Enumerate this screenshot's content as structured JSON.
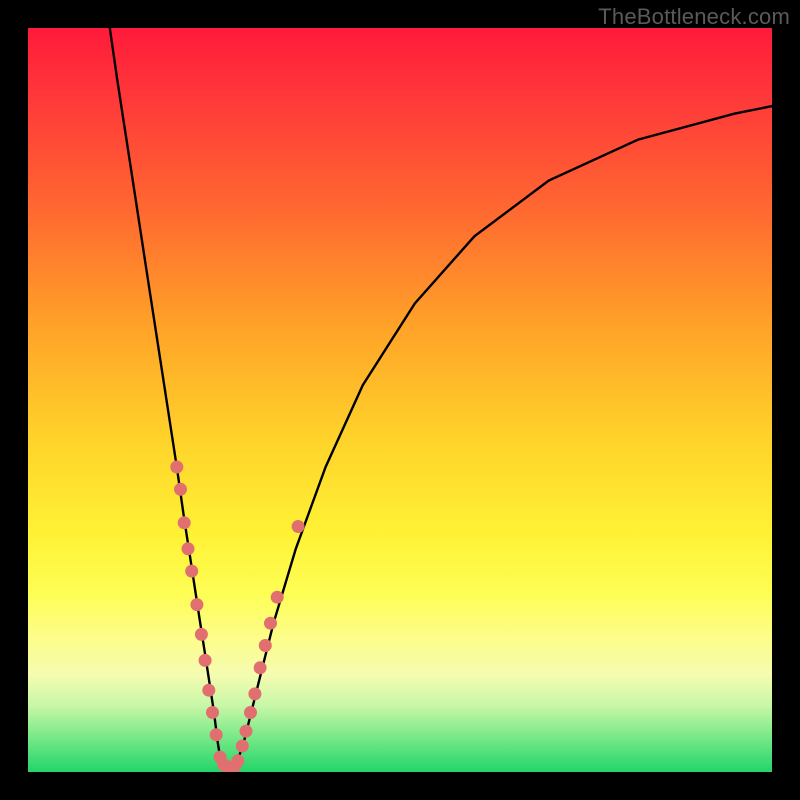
{
  "watermark": "TheBottleneck.com",
  "chart_data": {
    "type": "line",
    "title": "",
    "xlabel": "",
    "ylabel": "",
    "xlim": [
      0,
      100
    ],
    "ylim": [
      0,
      100
    ],
    "series": [
      {
        "name": "left-branch",
        "x": [
          11,
          12,
          14,
          16,
          18,
          20,
          21,
          22,
          23,
          24,
          25,
          25.5,
          26
        ],
        "y": [
          100,
          93,
          80,
          67,
          54,
          41,
          34,
          27.5,
          21,
          14.5,
          8,
          4,
          1
        ]
      },
      {
        "name": "right-branch",
        "x": [
          28,
          29,
          30,
          31,
          33,
          36,
          40,
          45,
          52,
          60,
          70,
          82,
          95,
          100
        ],
        "y": [
          1,
          4,
          8,
          12,
          20,
          30,
          41,
          52,
          63,
          72,
          79.5,
          85,
          88.5,
          89.5
        ]
      }
    ],
    "scatter": [
      {
        "name": "markers-left",
        "points": [
          {
            "x": 20.0,
            "y": 41.0
          },
          {
            "x": 20.5,
            "y": 38.0
          },
          {
            "x": 21.0,
            "y": 33.5
          },
          {
            "x": 21.5,
            "y": 30.0
          },
          {
            "x": 22.0,
            "y": 27.0
          },
          {
            "x": 22.7,
            "y": 22.5
          },
          {
            "x": 23.3,
            "y": 18.5
          },
          {
            "x": 23.8,
            "y": 15.0
          },
          {
            "x": 24.3,
            "y": 11.0
          },
          {
            "x": 24.8,
            "y": 8.0
          },
          {
            "x": 25.3,
            "y": 5.0
          }
        ]
      },
      {
        "name": "markers-bottom",
        "points": [
          {
            "x": 25.8,
            "y": 2.0
          },
          {
            "x": 26.3,
            "y": 1.0
          },
          {
            "x": 26.6,
            "y": 0.8
          },
          {
            "x": 27.0,
            "y": 0.6
          },
          {
            "x": 27.4,
            "y": 0.6
          },
          {
            "x": 27.8,
            "y": 0.8
          },
          {
            "x": 28.2,
            "y": 1.5
          }
        ]
      },
      {
        "name": "markers-right",
        "points": [
          {
            "x": 28.8,
            "y": 3.5
          },
          {
            "x": 29.3,
            "y": 5.5
          },
          {
            "x": 29.9,
            "y": 8.0
          },
          {
            "x": 30.5,
            "y": 10.5
          },
          {
            "x": 31.2,
            "y": 14.0
          },
          {
            "x": 31.9,
            "y": 17.0
          },
          {
            "x": 32.6,
            "y": 20.0
          },
          {
            "x": 33.5,
            "y": 23.5
          },
          {
            "x": 36.3,
            "y": 33.0
          }
        ]
      }
    ],
    "colors": {
      "curve": "#000000",
      "marker": "#e26f6f"
    }
  }
}
